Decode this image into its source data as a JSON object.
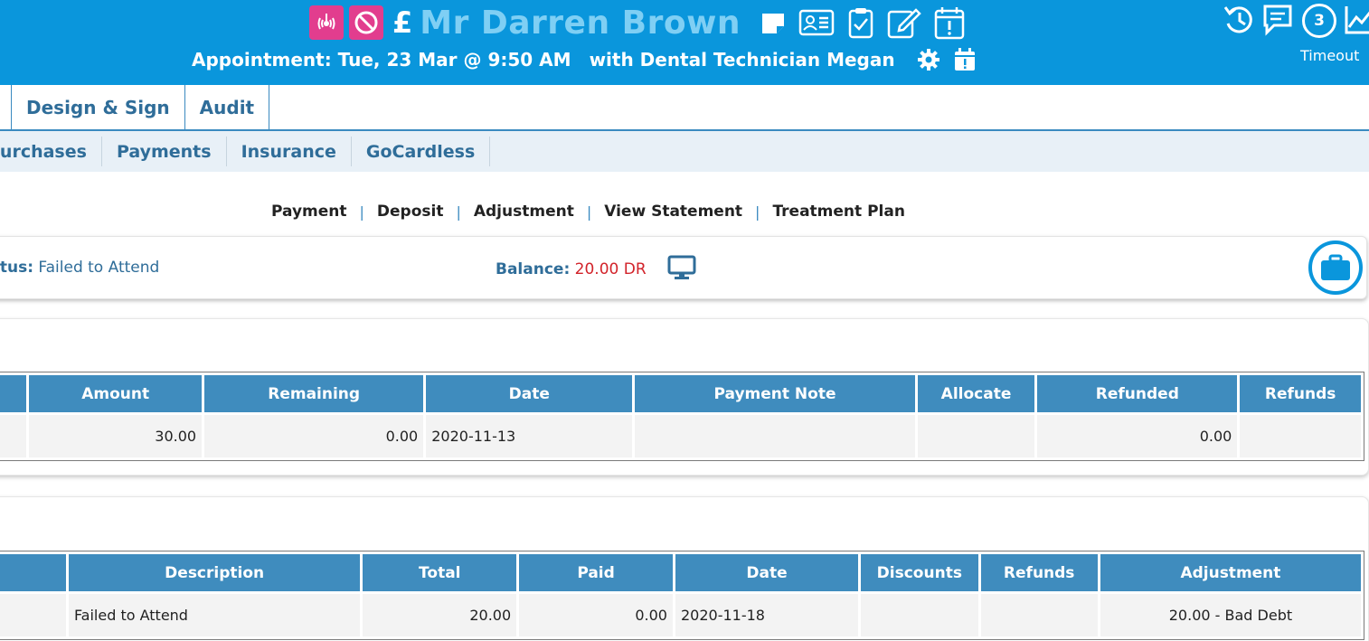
{
  "header": {
    "patient_name": "Mr Darren Brown",
    "currency_symbol": "£",
    "appointment_text": "Appointment: Tue, 23 Mar @ 9:50 AM",
    "appointment_with": "with Dental Technician Megan",
    "notification_count": "3",
    "timeout_label": "Timeout",
    "colors": {
      "bar": "#0a96dc",
      "name": "#7fcff4",
      "alert": "#e23d8e"
    }
  },
  "main_tabs": [
    "Design & Sign",
    "Audit"
  ],
  "sub_tabs": [
    "Purchases",
    "Payments",
    "Insurance",
    "GoCardless"
  ],
  "action_links": [
    "Payment",
    "Deposit",
    "Adjustment",
    "View Statement",
    "Treatment Plan"
  ],
  "status": {
    "label": "Status:",
    "value": "Failed to Attend",
    "balance_label": "Balance:",
    "balance_value": "20.00 DR",
    "balance_color": "#d2232a"
  },
  "payments_table": {
    "headers": [
      "Amount",
      "Remaining",
      "Date",
      "Payment Note",
      "Allocate",
      "Refunded",
      "Refunds"
    ],
    "rows": [
      {
        "amount": "30.00",
        "remaining": "0.00",
        "date": "2020-11-13",
        "payment_note": "",
        "allocate": "",
        "refunded": "0.00",
        "refunds": ""
      }
    ]
  },
  "purchases_table": {
    "headers": [
      "Description",
      "Total",
      "Paid",
      "Date",
      "Discounts",
      "Refunds",
      "Adjustment"
    ],
    "rows": [
      {
        "description": "Failed to Attend",
        "total": "20.00",
        "paid": "0.00",
        "date": "2020-11-18",
        "discounts": "",
        "refunds": "",
        "adjustment": "20.00 - Bad Debt"
      }
    ]
  }
}
